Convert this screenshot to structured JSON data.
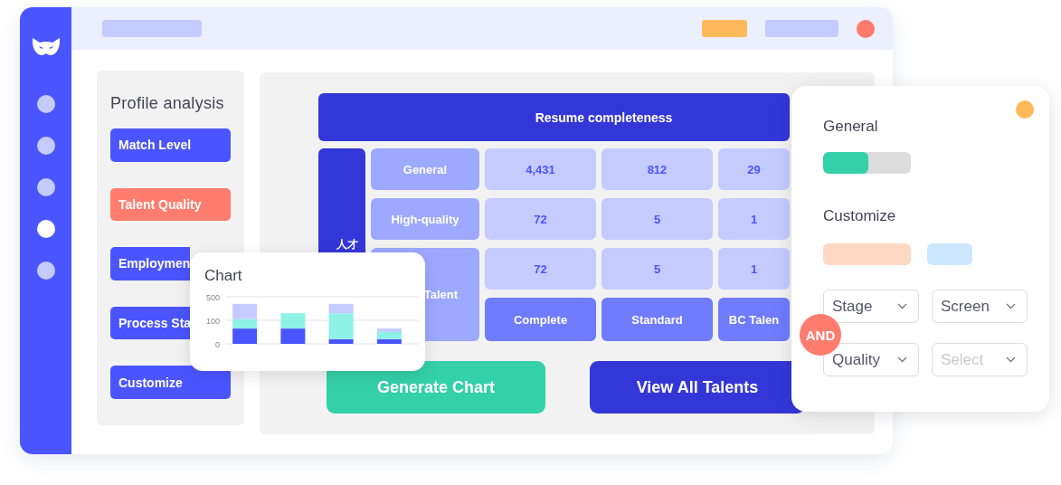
{
  "sidebar": {
    "items": [
      {
        "selected": false
      },
      {
        "selected": false
      },
      {
        "selected": false
      },
      {
        "selected": true
      },
      {
        "selected": false
      }
    ]
  },
  "profile_panel": {
    "title": "Profile analysis",
    "buttons": [
      {
        "label": "Match Level",
        "kind": "primary"
      },
      {
        "label": "Talent Quality",
        "kind": "accent"
      },
      {
        "label": "Employmen",
        "kind": "partial"
      },
      {
        "label": "Process Sta",
        "kind": "partial"
      },
      {
        "label": "Customize",
        "kind": "primary"
      }
    ]
  },
  "table": {
    "header": "Resume completeness",
    "side_label": "人才",
    "rows": [
      {
        "label": "General",
        "cells": [
          "4,431",
          "812",
          "29"
        ]
      },
      {
        "label": "High-quality",
        "cells": [
          "72",
          "5",
          "1"
        ]
      },
      {
        "label": "Talent",
        "cells": [
          "72",
          "5",
          "1"
        ],
        "kind": "spanning"
      },
      {
        "cells": [
          "Complete",
          "Standard",
          "BC Talen"
        ],
        "kind": "column_labels"
      }
    ]
  },
  "actions": [
    {
      "label": "Generate Chart",
      "kind": "secondary"
    },
    {
      "label": "View All Talents",
      "kind": "primary"
    }
  ],
  "chart_card": {
    "title": "Chart",
    "axis_labels": [
      "500",
      "100",
      "0"
    ]
  },
  "filter_card": {
    "general_label": "General",
    "general_bar": {
      "level": 0.52
    },
    "customize_label": "Customize",
    "chips": [
      {
        "color": "#ffd8c4"
      },
      {
        "color": "#cce6ff"
      }
    ],
    "dropdowns": [
      {
        "value": "Stage"
      },
      {
        "value": "Screen"
      },
      {
        "value": "Quality"
      },
      {
        "placeholder": "Select"
      }
    ],
    "operator": "AND"
  }
}
